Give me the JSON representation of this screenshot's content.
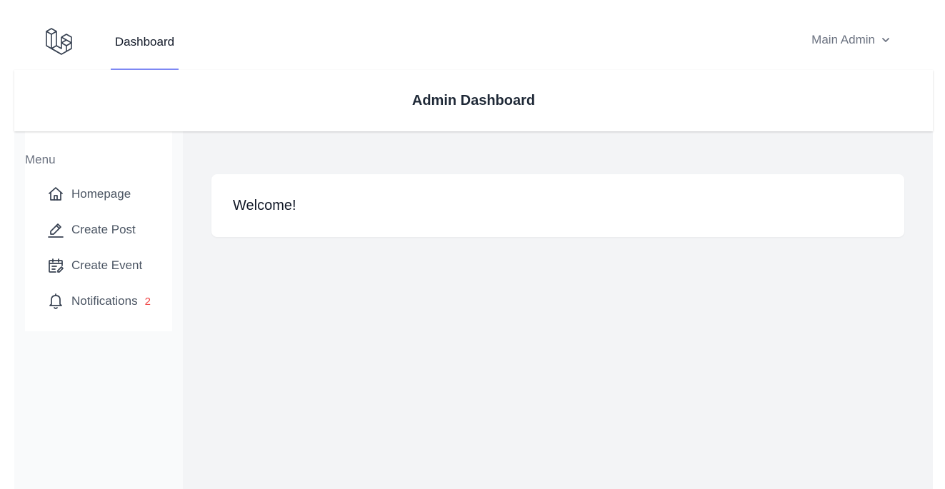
{
  "topnav": {
    "logo_icon": "laravel-logo-icon",
    "dashboard_link": "Dashboard",
    "user_name": "Main Admin",
    "user_chevron_icon": "chevron-down-icon"
  },
  "header": {
    "title": "Admin Dashboard"
  },
  "sidebar": {
    "title": "Menu",
    "items": [
      {
        "label": "Homepage",
        "icon": "home-icon"
      },
      {
        "label": "Create Post",
        "icon": "pencil-icon"
      },
      {
        "label": "Create Event",
        "icon": "calendar-edit-icon"
      },
      {
        "label": "Notifications",
        "icon": "bell-icon",
        "badge": "2"
      }
    ]
  },
  "main": {
    "welcome_text": "Welcome!"
  },
  "colors": {
    "accent": "#818cf8",
    "badge": "#ef4444",
    "main_bg": "#f3f4f6",
    "sidebar_bg": "#f9fafb"
  }
}
